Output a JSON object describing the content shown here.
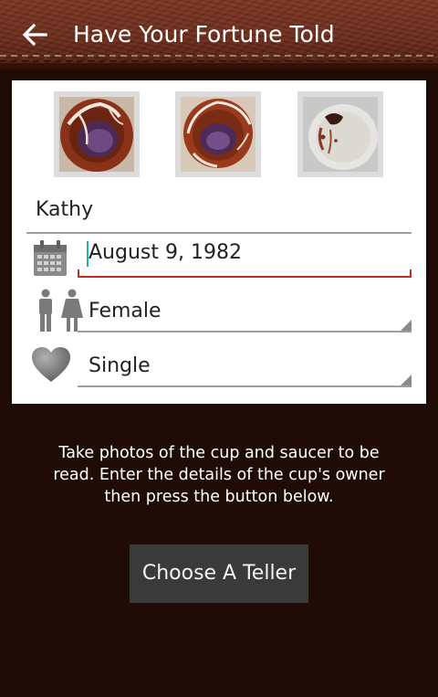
{
  "app_bar": {
    "title": "Have Your Fortune Told",
    "back_icon": "arrow-left-icon"
  },
  "photos": [
    {
      "name": "cup-photo-1",
      "icon": "cup-inside-photo"
    },
    {
      "name": "cup-photo-2",
      "icon": "cup-inside-photo"
    },
    {
      "name": "saucer-photo",
      "icon": "saucer-photo"
    }
  ],
  "form": {
    "name_value": "Kathy",
    "birthdate_value": "August 9, 1982",
    "birthdate_icon": "calendar-icon",
    "gender_icon": "male-female-icon",
    "gender_value": "Female",
    "status_icon": "heart-icon",
    "status_value": "Single"
  },
  "instructions": "Take photos of the cup and saucer to be read. Enter the details of the cup's owner then press the button below.",
  "actions": {
    "choose_teller_label": "Choose A Teller"
  },
  "colors": {
    "background": "#200c06",
    "app_bar": "#6b2c1a",
    "focus_underline": "#c62828",
    "cursor": "#1fb5a5",
    "button": "#3a3a3a"
  }
}
